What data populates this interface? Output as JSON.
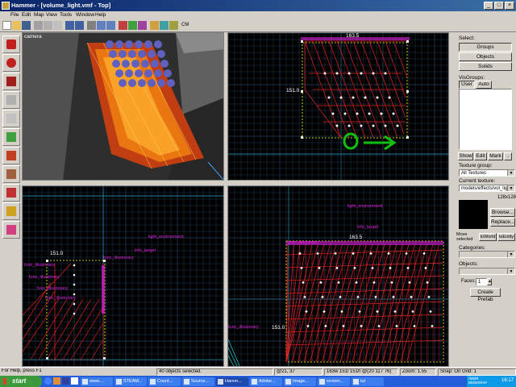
{
  "window": {
    "title": "Hammer - [volume_light.vmf - Top]"
  },
  "menu": [
    "File",
    "Edit",
    "Map",
    "View",
    "Tools",
    "Window",
    "Help"
  ],
  "toolbar": {
    "cm_label": "CM"
  },
  "viewports": {
    "camera": {
      "label": "camera"
    },
    "top": {
      "dim_width": "163.5",
      "dim_height": "151.0"
    },
    "bottom_left": {
      "dim": "151.0",
      "labels": [
        "light_environment",
        "info_target",
        "func_illusionary",
        "func_illusionary",
        "func_illusionary",
        "func_illusionary",
        "func_illusionary"
      ]
    },
    "bottom_right": {
      "dim_width": "163.5",
      "dim_height": "151.0",
      "labels": [
        "light_environment",
        "info_target",
        "func_illusionary",
        "func_illusionary"
      ]
    }
  },
  "right_panel": {
    "select_label": "Select:",
    "groups_btn": "Groups",
    "objects_btn": "Objects",
    "solids_btn": "Solids",
    "visgroups_label": "VisGroups:",
    "tab_user": "User",
    "tab_auto": "Auto",
    "show_btn": "Show",
    "edit_btn": "Edit",
    "mark_btn": "Mark",
    "texture_group_label": "Texture group:",
    "texture_group_value": "All Textures",
    "current_texture_label": "Current texture:",
    "current_texture_value": "models/effects/vol_ligh",
    "texture_size": "128x128",
    "browse_btn": "Browse...",
    "replace_btn": "Replace...",
    "move_selected_label": "Move selected",
    "to_world_btn": "toWorld",
    "to_entity_btn": "toEntity",
    "categories_label": "Categories:",
    "objects_label": "Objects:",
    "faces_label": "Faces:",
    "faces_value": "1",
    "create_prefab_btn": "Create Prefab"
  },
  "status": {
    "help": "For Help, press F1",
    "selection": "40 objects selected.",
    "coords": "@21, 37",
    "size": "163w 151l 151h @(20 117 76)",
    "zoom": "Zoom: 1.55",
    "snap": "Snap: On Grid: 1"
  },
  "taskbar": {
    "start": "start",
    "tasks": [
      "www....",
      "STEAM...",
      "Count...",
      "Source...",
      "Hamm...",
      "Adobe...",
      "Image...",
      "screen...",
      "tut"
    ],
    "clock": "16:17",
    "tray_text": "ЛИВЯ ВЕБМОНИ"
  },
  "colors": {
    "grid_minor": "#243a52",
    "grid_major": "#3c5f82",
    "brush": "#e02020",
    "entity": "#e020e0",
    "selection": "#ffff00",
    "arrow": "#10c010"
  }
}
